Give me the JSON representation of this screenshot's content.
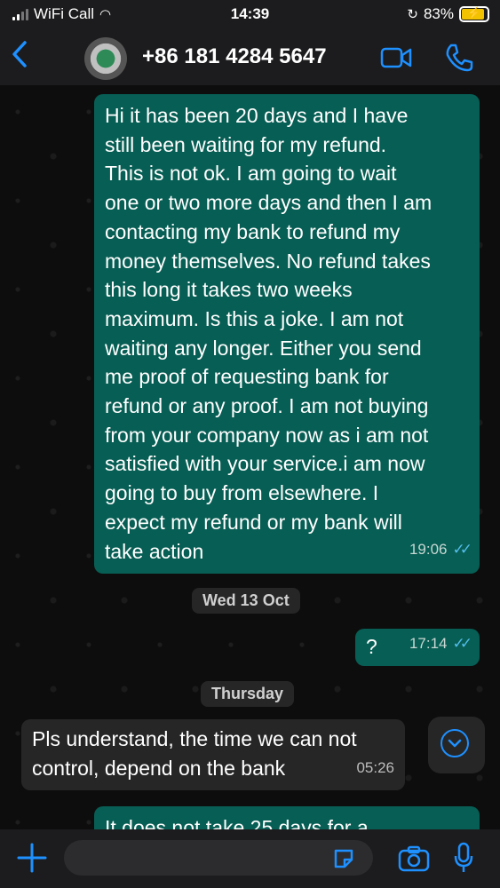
{
  "status": {
    "carrier": "WiFi Call",
    "time": "14:39",
    "battery": "83%",
    "battery_level": 0.83
  },
  "header": {
    "contact": "+86 181 4284 5647",
    "back_icon": "chevron-left-icon",
    "video_icon": "video-call-icon",
    "phone_icon": "phone-icon"
  },
  "messages": [
    {
      "direction": "out",
      "lines": [
        "Hi it has been 20 days and I have",
        "still been waiting for my refund.",
        "This is not ok. I am going to wait",
        "one or two more days and then I am",
        "contacting my bank to refund my",
        "money themselves. No refund takes",
        "this long it takes two weeks",
        "maximum. Is this a joke. I am not",
        "waiting any longer. Either you send",
        "me proof of requesting bank for",
        "refund or any proof. I am not buying",
        "from your company now as i am not",
        "satisfied with your service.i am now",
        "going to buy from elsewhere. I",
        "expect my refund or my bank will",
        "take action"
      ],
      "time": "19:06"
    },
    {
      "type": "date",
      "label": "Wed 13 Oct"
    },
    {
      "direction": "out",
      "text": "?",
      "time": "17:14"
    },
    {
      "type": "date",
      "label": "Thursday"
    },
    {
      "direction": "in",
      "lines": [
        "Pls understand, the time we can not",
        "control, depend on the bank"
      ],
      "time": "05:26"
    },
    {
      "direction": "out",
      "text": "It does not take 25 days for a"
    }
  ],
  "colors": {
    "outgoing": "#075e54",
    "incoming": "#262626",
    "accent": "#1e90ff",
    "read_ticks": "#53bdeb"
  }
}
